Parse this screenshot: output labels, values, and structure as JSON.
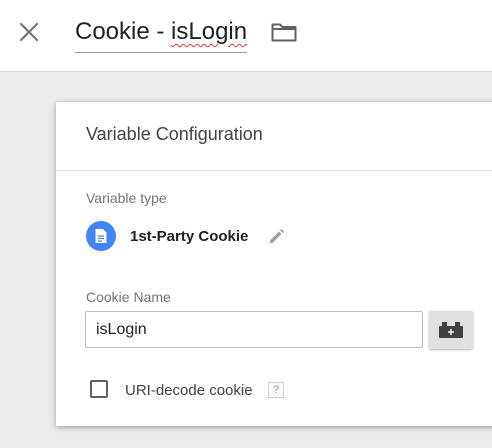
{
  "header": {
    "title_prefix": "Cookie - ",
    "title_name": "isLogin",
    "close_icon": "close-icon",
    "folder_icon": "folder-icon"
  },
  "card": {
    "title": "Variable Configuration",
    "variable_type": {
      "label": "Variable type",
      "value": "1st-Party Cookie",
      "icon": "document-icon",
      "edit_icon": "pencil-icon"
    },
    "cookie_name": {
      "label": "Cookie Name",
      "value": "isLogin",
      "insert_variable_icon": "lego-brick-icon"
    },
    "uri_decode": {
      "label": "URI-decode cookie",
      "checked": false,
      "help": "?"
    }
  },
  "colors": {
    "accent_blue": "#4285f4",
    "background": "#ebebeb",
    "spellcheck_red": "#e53935"
  }
}
